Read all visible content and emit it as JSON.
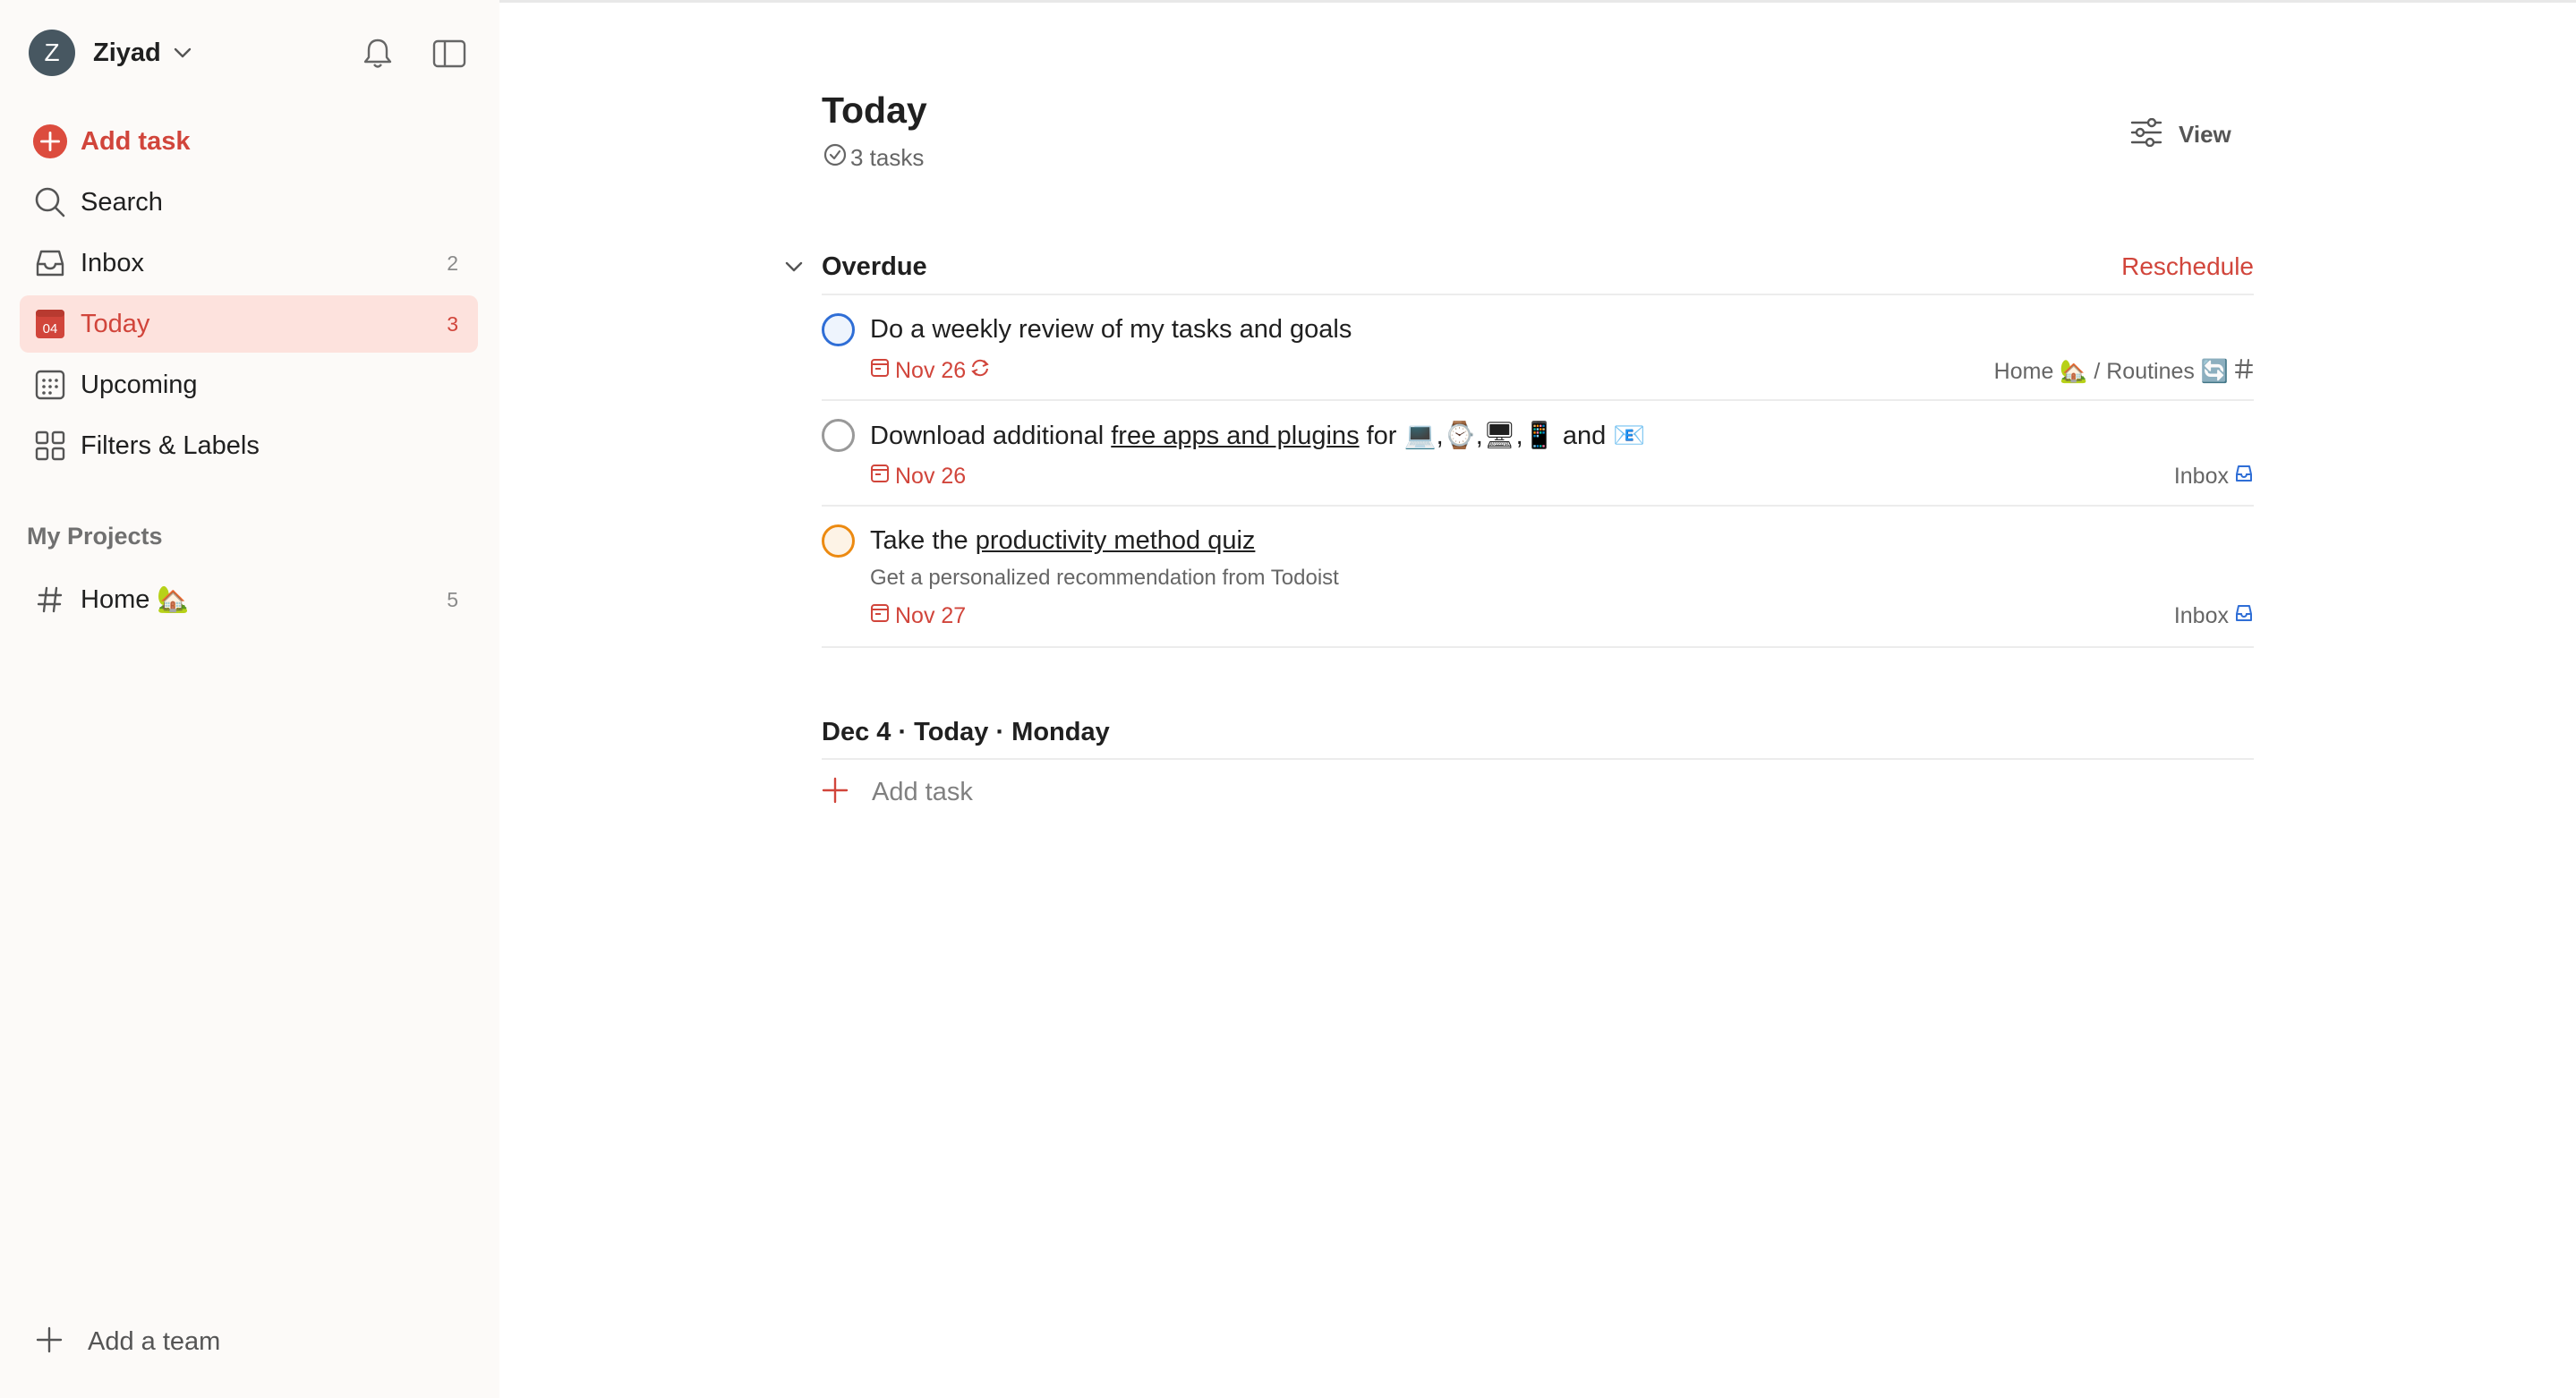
{
  "sidebar": {
    "account_initial": "Z",
    "account_name": "Ziyad",
    "add_task_label": "Add task",
    "items": [
      {
        "label": "Search",
        "count": ""
      },
      {
        "label": "Inbox",
        "count": "2"
      },
      {
        "label": "Today",
        "count": "3",
        "icon_text": "04"
      },
      {
        "label": "Upcoming",
        "count": ""
      },
      {
        "label": "Filters & Labels",
        "count": ""
      }
    ],
    "projects_title": "My Projects",
    "projects": [
      {
        "label": "Home 🏡",
        "count": "5"
      }
    ],
    "add_team_label": "Add a team"
  },
  "main": {
    "title": "Today",
    "task_count": "3 tasks",
    "view_label": "View",
    "overdue": {
      "title": "Overdue",
      "reschedule_label": "Reschedule",
      "tasks": [
        {
          "title": "Do a weekly review of my tasks and goals",
          "due": "Nov 26",
          "project": "Home 🏡 / Routines 🔄",
          "project_icon": "hash-icon",
          "priority_color": "#2f6ed6"
        },
        {
          "title_before": "Download additional ",
          "title_link": "free apps and plugins",
          "title_after": " for 💻,⌚,🖥,📱 and 📧",
          "due": "Nov 26",
          "project": "Inbox",
          "project_icon": "inbox-icon",
          "priority_color": "#999999"
        },
        {
          "title_before": "Take the ",
          "title_link": "productivity method quiz",
          "description": "Get a personalized recommendation from Todoist",
          "due": "Nov 27",
          "project": "Inbox",
          "project_icon": "inbox-icon",
          "priority_color": "#ec8a11"
        }
      ]
    },
    "today_section": {
      "title": "Dec 4 · Today · Monday",
      "add_task_label": "Add task"
    }
  },
  "colors": {
    "accent": "#d1453b",
    "sidebar_bg": "#fcfaf8",
    "active_bg": "#fde2dd"
  }
}
